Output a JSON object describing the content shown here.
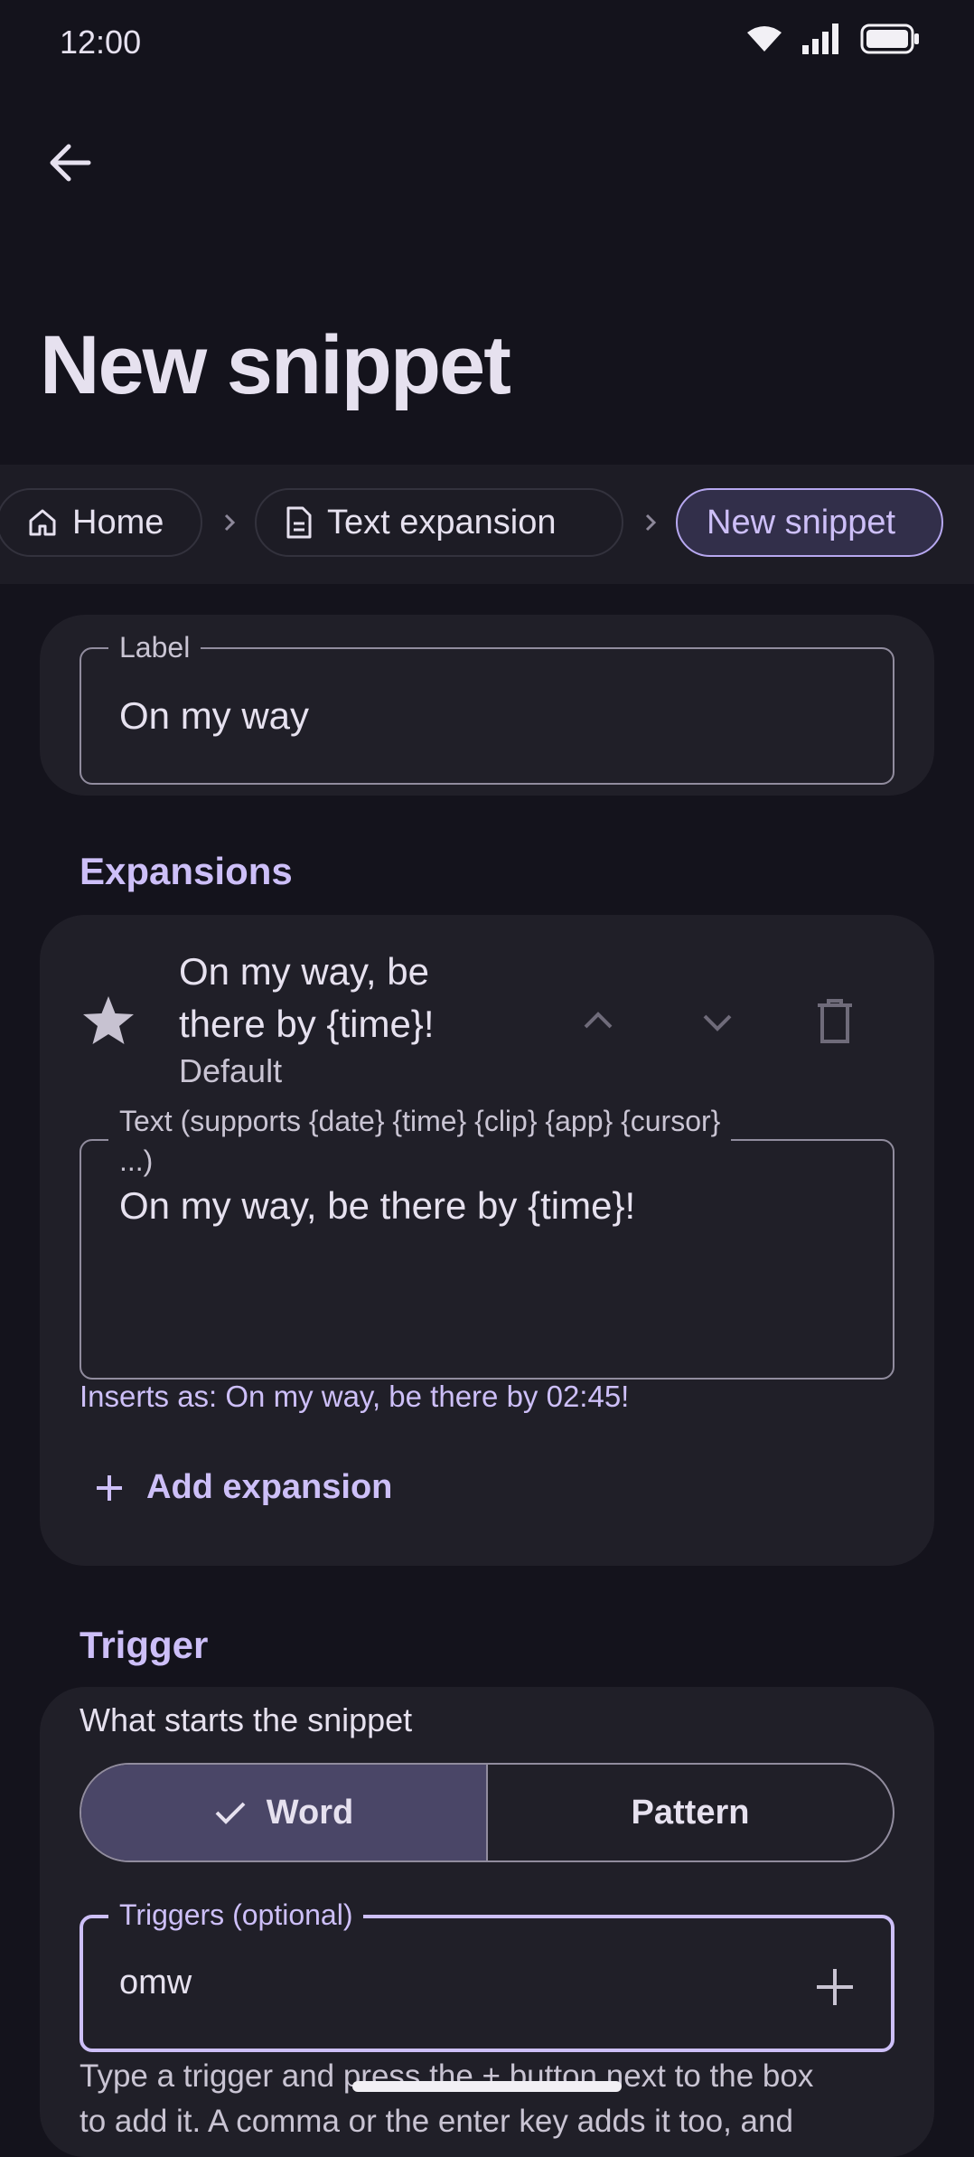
{
  "status": {
    "time": "12:00"
  },
  "page": {
    "title": "New snippet"
  },
  "breadcrumb": {
    "home": "Home",
    "text_expansion": "Text expansion",
    "current": "New snippet"
  },
  "label_field": {
    "label": "Label",
    "value": "On my way"
  },
  "expansions": {
    "title": "Expansions",
    "item": {
      "title_line1": "On my way, be",
      "title_line2": "there by {time}!",
      "subtitle": "Default"
    },
    "text_field": {
      "label_line1": "Text (supports {date} {time} {clip} {app} {cursor}",
      "label_line2": "...)",
      "value": "On my way, be there by {time}!"
    },
    "preview": "Inserts as: On my way, be there by 02:45!",
    "add_label": "Add expansion"
  },
  "trigger": {
    "title": "Trigger",
    "description": "What starts the snippet",
    "options": [
      "Word",
      "Pattern"
    ],
    "selected": "Word",
    "triggers_field": {
      "label": "Triggers (optional)",
      "value": "omw"
    },
    "help_line1": "Type a trigger and press the + button next to the box",
    "help_line2": "to add it. A comma or the enter key adds it too, and"
  },
  "colors": {
    "accent": "#cdbff8",
    "background": "#14131c",
    "card": "#201f28"
  }
}
